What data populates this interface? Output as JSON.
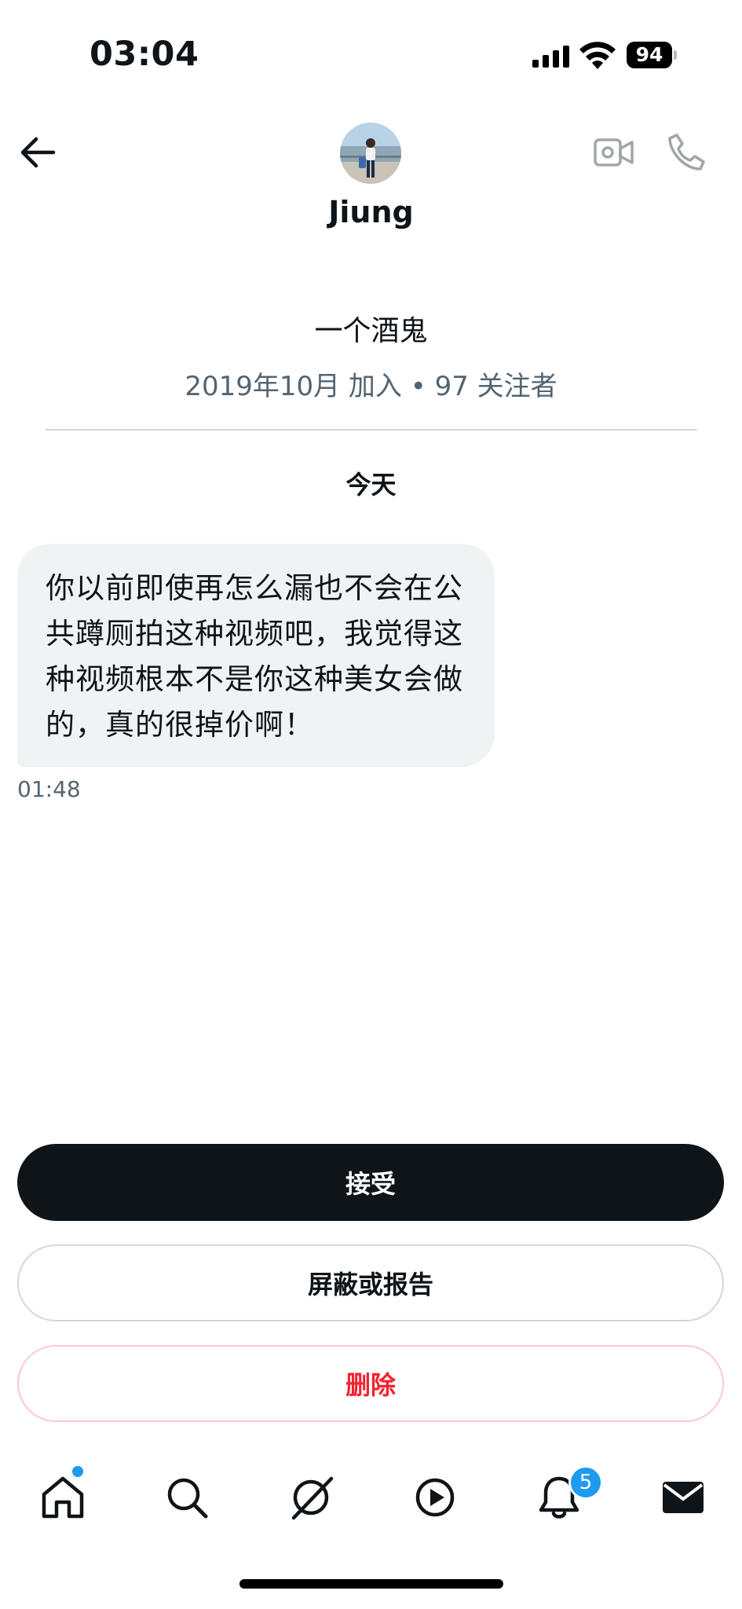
{
  "status_bar": {
    "time": "03:04",
    "battery_level": "94",
    "icons": [
      "cellular-signal-icon",
      "wifi-icon",
      "battery-icon"
    ]
  },
  "header": {
    "contact_name": "Jiung",
    "icons": [
      "back-arrow-icon",
      "video-camera-icon",
      "phone-icon"
    ]
  },
  "profile": {
    "bio": "一个酒鬼",
    "meta": "2019年10月 加入 • 97 关注者"
  },
  "conversation": {
    "date_separator": "今天",
    "messages": [
      {
        "text": "你以前即使再怎么漏也不会在公共蹲厕拍这种视频吧，我觉得这种视频根本不是你这种美女会做的，真的很掉价啊！",
        "time": "01:48"
      }
    ]
  },
  "actions": {
    "accept_label": "接受",
    "block_report_label": "屏蔽或报告",
    "delete_label": "删除"
  },
  "tab_bar": {
    "items": [
      "home-icon",
      "search-icon",
      "grok-icon",
      "video-play-icon",
      "notifications-bell-icon",
      "mail-icon"
    ],
    "notifications_badge": "5"
  },
  "colors": {
    "accent": "#1d9bf0",
    "primary_button": "#0f1419",
    "danger": "#f4212e",
    "bubble_bg": "#eff3f4",
    "muted_text": "#536471"
  }
}
